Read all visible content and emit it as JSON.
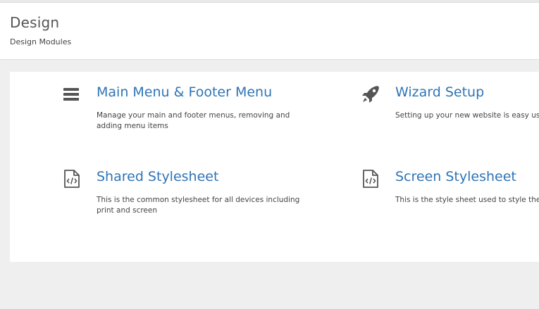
{
  "header": {
    "title": "Design",
    "subtitle": "Design Modules"
  },
  "modules": [
    {
      "title": "Main Menu & Footer Menu",
      "description": "Manage your main and footer menus, removing and adding menu items",
      "icon": "hamburger-menu-icon"
    },
    {
      "title": "Wizard Setup",
      "description": "Setting up your new website is easy usir",
      "icon": "rocket-icon"
    },
    {
      "title": "Shared Stylesheet",
      "description": "This is the common stylesheet for all devices including print and screen",
      "icon": "code-file-icon"
    },
    {
      "title": "Screen Stylesheet",
      "description": "This is the style sheet used to style the s the website",
      "icon": "code-file-icon"
    }
  ],
  "colors": {
    "link": "#2f74b5",
    "background": "#efefef",
    "panel": "#ffffff"
  }
}
